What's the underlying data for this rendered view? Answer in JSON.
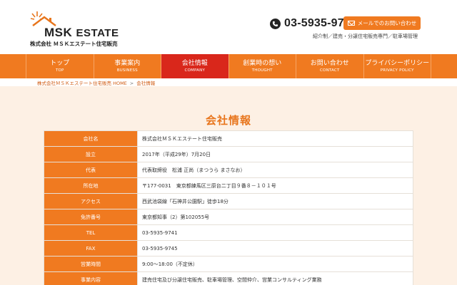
{
  "header": {
    "logo_brand": "MSK",
    "logo_estate": "ESTATE",
    "logo_company": "株式会社 ＭＳＫエステート住宅販売",
    "phone": "03-5935-9741",
    "mail_button": "メールでのお問い合わせ",
    "tagline": "紹介制／建売・分譲住宅販売専門／駐車場管理",
    "accent_color": "#f07a20"
  },
  "nav": {
    "items": [
      {
        "jp": "トップ",
        "en": "TOP"
      },
      {
        "jp": "事業案内",
        "en": "BUSINESS"
      },
      {
        "jp": "会社情報",
        "en": "COMPANY"
      },
      {
        "jp": "創業時の想い",
        "en": "THOUGHT"
      },
      {
        "jp": "お問い合わせ",
        "en": "CONTACT"
      },
      {
        "jp": "プライバシーポリシー",
        "en": "PRIVACY POLICY"
      }
    ],
    "active_color": "#d9271b"
  },
  "breadcrumb": {
    "home": "株式会社ＭＳＫエステート住宅販売 HOME",
    "separator": ">",
    "current": "会社情報"
  },
  "page_title": "会社情報",
  "company_table": [
    {
      "label": "会社名",
      "value": "株式会社ＭＳＫエステート住宅販売"
    },
    {
      "label": "設立",
      "value": "2017年（平成29年）7月20日"
    },
    {
      "label": "代表",
      "value": "代表取締役　松浦 正尚（まつうら まさなお）"
    },
    {
      "label": "所在地",
      "value": "〒177-0031　東京都練馬区三原台二丁目９番８－１０１号"
    },
    {
      "label": "アクセス",
      "value": "西武池袋線「石神井公園駅」徒歩18分"
    },
    {
      "label": "免許番号",
      "value": "東京都知事（2）第102055号"
    },
    {
      "label": "TEL",
      "value": "03-5935-9741"
    },
    {
      "label": "FAX",
      "value": "03-5935-9745"
    },
    {
      "label": "営業時間",
      "value": "9:00～18:00（不定休）"
    },
    {
      "label": "事業内容",
      "value": "建売住宅及び分譲住宅販売、駐車場管理、空間仲介、営業コンサルティング業務"
    }
  ]
}
